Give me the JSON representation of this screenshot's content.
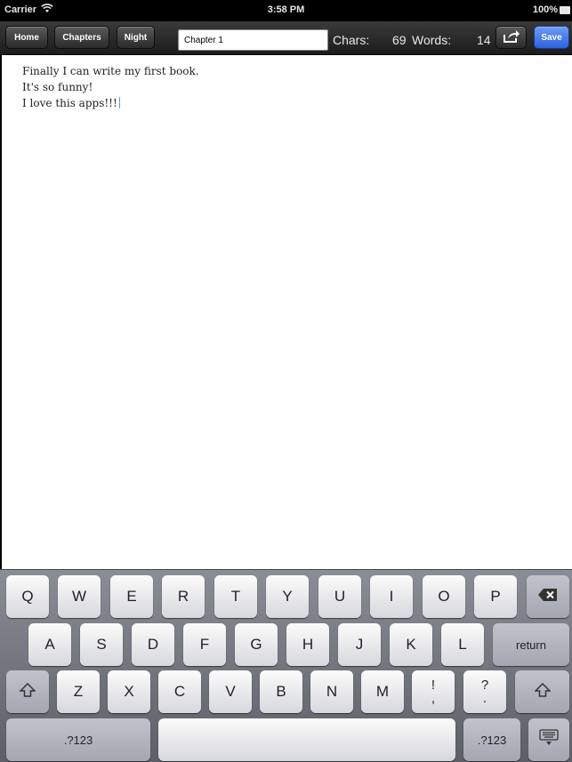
{
  "status_bar": {
    "carrier": "Carrier",
    "wifi_icon": "wifi-icon",
    "time": "3:58 PM",
    "battery_percent": "100%"
  },
  "toolbar": {
    "home_label": "Home",
    "chapters_label": "Chapters",
    "night_label": "Night",
    "chapter_title_value": "Chapter 1",
    "chars_label": "Chars:",
    "chars_value": "69",
    "words_label": "Words:",
    "words_value": "14",
    "share_icon": "share-icon",
    "save_label": "Save",
    "save_color": "#2c62e0"
  },
  "editor": {
    "lines": [
      "Finally I can write my first book.",
      "It's so funny!",
      "I love this apps!!!"
    ]
  },
  "keyboard": {
    "row1": [
      "Q",
      "W",
      "E",
      "R",
      "T",
      "Y",
      "U",
      "I",
      "O",
      "P"
    ],
    "backspace_icon": "backspace-icon",
    "row2": [
      "A",
      "S",
      "D",
      "F",
      "G",
      "H",
      "J",
      "K",
      "L"
    ],
    "return_label": "return",
    "shift_icon": "shift-icon",
    "row3": [
      "Z",
      "X",
      "C",
      "V",
      "B",
      "N",
      "M"
    ],
    "exclam_top": "!",
    "exclam_bottom": ",",
    "question_top": "?",
    "question_bottom": ".",
    "numbers_label": ".?123",
    "hide_keyboard_icon": "keyboard-hide-icon"
  }
}
